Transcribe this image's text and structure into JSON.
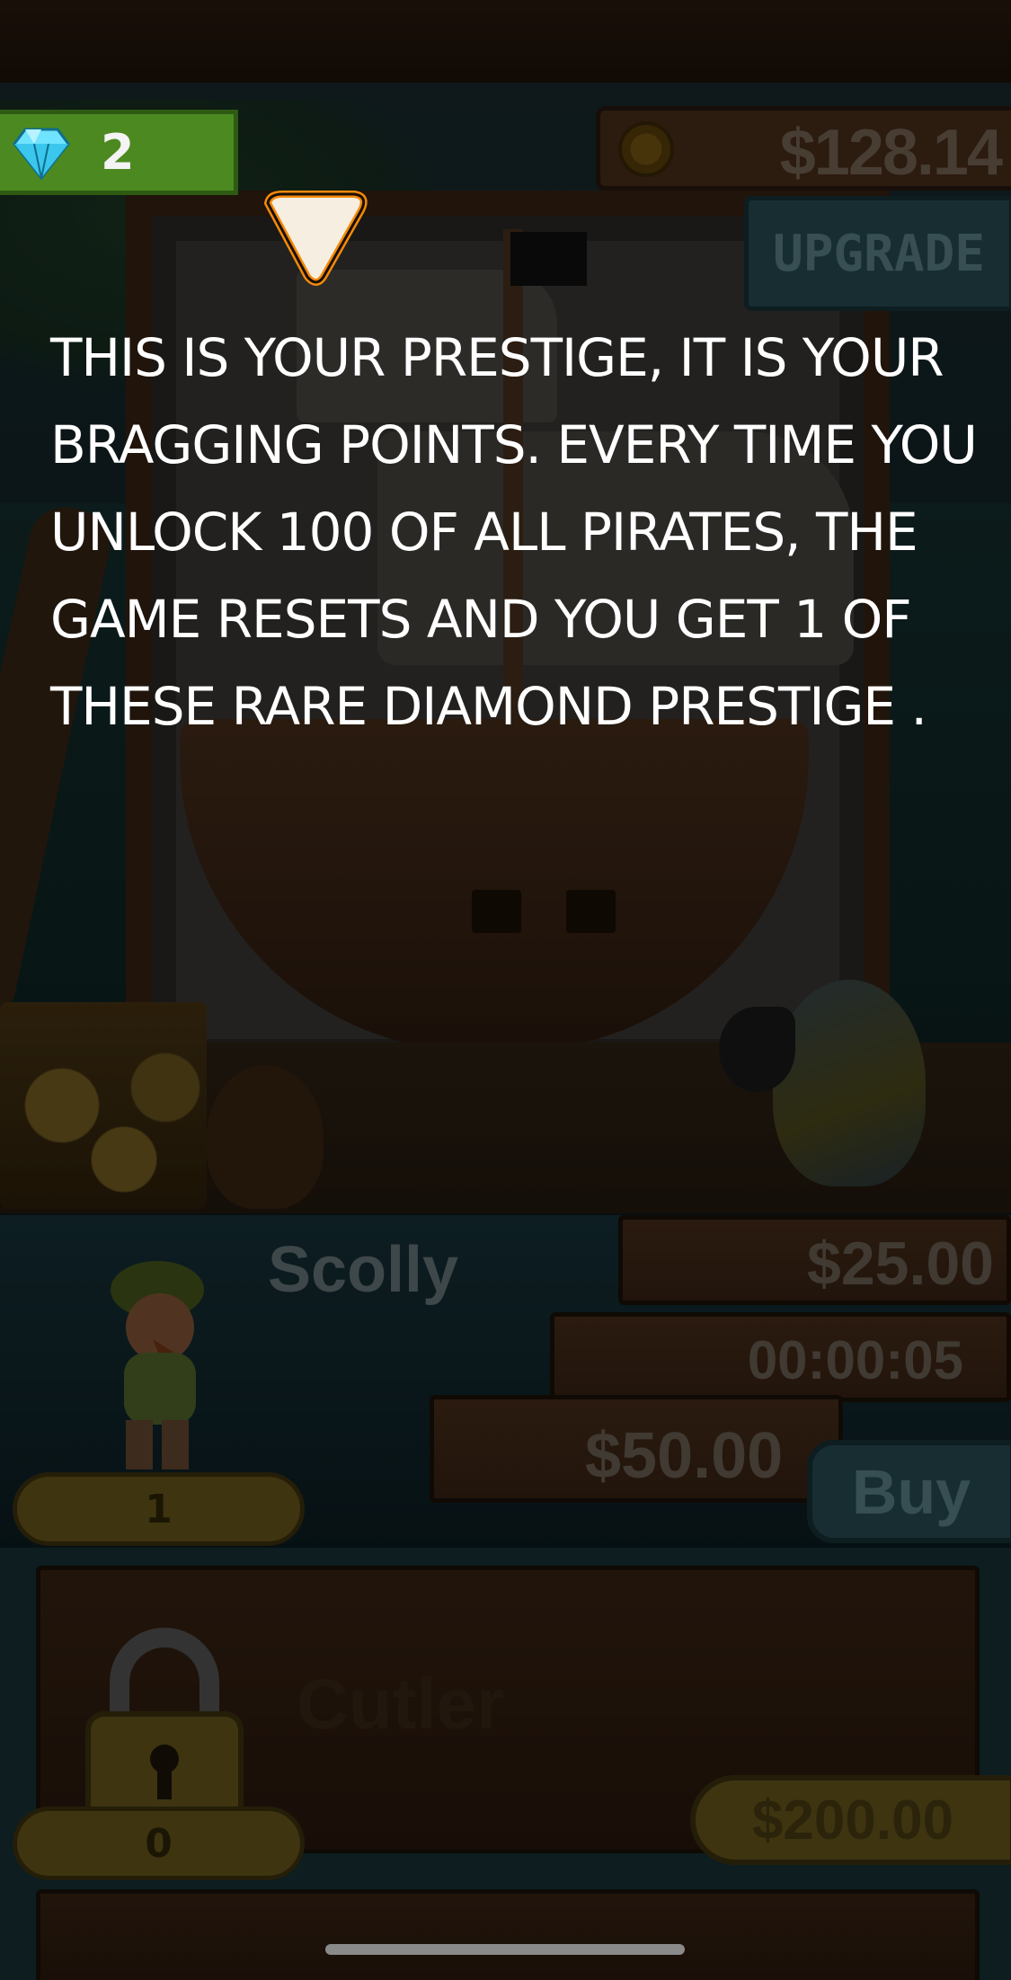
{
  "hud": {
    "diamonds": "2",
    "money": "$128.14",
    "upgrade_label": "UPGRADE"
  },
  "tutorial": {
    "text": "THIS IS YOUR PRESTIGE, IT IS YOUR BRAGGING POINTS. EVERY TIME YOU UNLOCK 100 OF ALL PIRATES, THE GAME RESETS AND YOU GET 1 OF THESE RARE DIAMOND PRESTIGE ."
  },
  "pirates": [
    {
      "name": "Scolly",
      "income": "$25.00",
      "timer": "00:00:05",
      "cost": "$50.00",
      "buy_label": "Buy",
      "level": "1"
    },
    {
      "name": "Cutler",
      "level": "0",
      "unlock_price": "$200.00",
      "locked": true
    }
  ],
  "icons": {
    "diamond": "diamond-icon",
    "coin": "coin-icon",
    "arrow": "tutorial-arrow-icon",
    "lock": "padlock-icon"
  },
  "colors": {
    "diamond_panel": "#4c8a21",
    "upgrade": "#2a4f56",
    "wood": "#4d2f1b",
    "gold_pill": "#6b5a1d"
  }
}
